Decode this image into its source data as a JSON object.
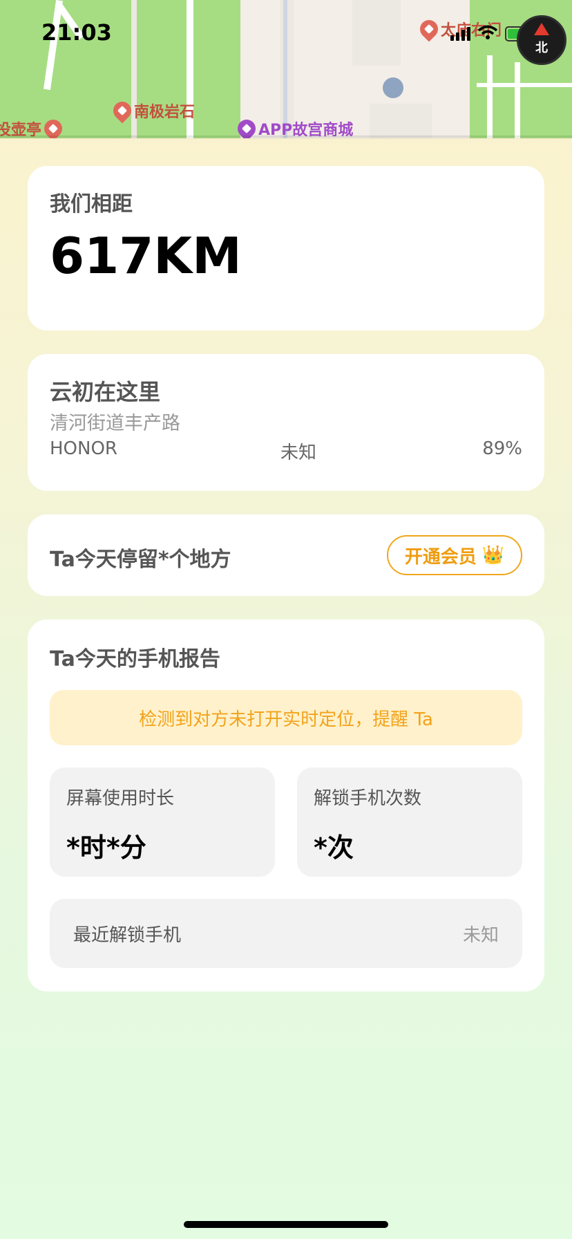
{
  "status_bar": {
    "time": "21:03"
  },
  "map": {
    "pois": [
      {
        "label": "南极岩石",
        "color": "#c2513f"
      },
      {
        "label": "APP故宫商城",
        "color": "#a14bc8"
      },
      {
        "label": "太庙右门",
        "color": "#c2513f"
      },
      {
        "label": "投壶亭",
        "color": "#c2513f"
      }
    ],
    "compass_label": "北"
  },
  "distance_card": {
    "label": "我们相距",
    "value": "617KM"
  },
  "location_card": {
    "title": "云初在这里",
    "address": "清河街道丰产路",
    "device": "HONOR",
    "network": "未知",
    "battery": "89%"
  },
  "places_card": {
    "text": "Ta今天停留*个地方",
    "vip_button": "开通会员",
    "vip_icon": "👑"
  },
  "report_card": {
    "title": "Ta今天的手机报告",
    "banner": "检测到对方未打开实时定位，提醒 Ta",
    "screen_time": {
      "label": "屏幕使用时长",
      "value": "*时*分"
    },
    "unlock_count": {
      "label": "解锁手机次数",
      "value": "*次"
    },
    "last_unlock": {
      "label": "最近解锁手机",
      "value": "未知"
    }
  },
  "colors": {
    "accent": "#f0a71c",
    "map_green": "#a6dd82"
  }
}
